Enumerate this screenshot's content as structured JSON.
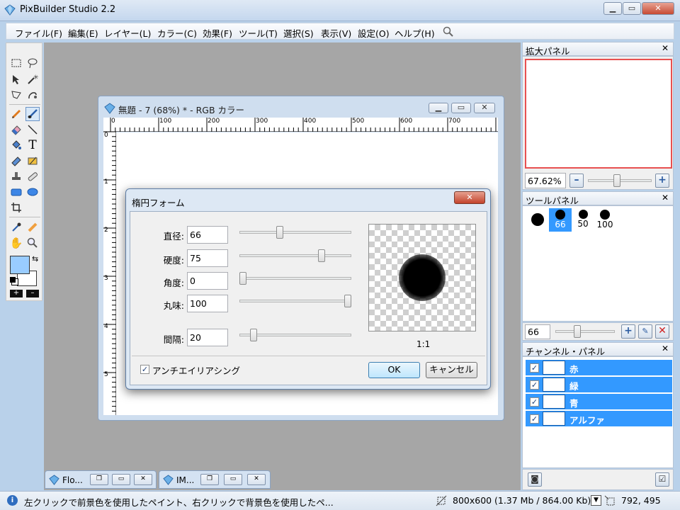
{
  "app": {
    "title": "PixBuilder Studio 2.2"
  },
  "menu": [
    "ファイル(F)",
    "編集(E)",
    "レイヤー(L)",
    "カラー(C)",
    "効果(F)",
    "ツール(T)",
    "選択(S)",
    "表示(V)",
    "設定(O)",
    "ヘルプ(H)"
  ],
  "document": {
    "title": "無題 - 7 (68%) * - RGB カラー",
    "ruler_h": [
      "0",
      "100",
      "200",
      "300",
      "400",
      "500",
      "600",
      "700"
    ],
    "ruler_v": [
      "0",
      "1",
      "2",
      "3",
      "4",
      "5"
    ]
  },
  "dialog": {
    "title": "楕円フォーム",
    "fields": [
      {
        "label": "直径:",
        "value": "66",
        "slider": 0.35
      },
      {
        "label": "硬度:",
        "value": "75",
        "slider": 0.75
      },
      {
        "label": "角度:",
        "value": "0",
        "slider": 0.0
      },
      {
        "label": "丸味:",
        "value": "100",
        "slider": 1.0
      },
      {
        "label": "間隔:",
        "value": "20",
        "slider": 0.1
      }
    ],
    "preview_label": "1:1",
    "antialias_label": "アンチエイリアシング",
    "antialias_checked": true,
    "ok_label": "OK",
    "cancel_label": "キャンセル"
  },
  "zoom_panel": {
    "title": "拡大パネル",
    "zoom_value": "67.62%",
    "minus": "–",
    "plus": "+"
  },
  "tool_panel": {
    "title": "ツールパネル",
    "brushes": [
      {
        "label": "",
        "selected": false
      },
      {
        "label": "66",
        "selected": true
      },
      {
        "label": "50",
        "selected": false
      },
      {
        "label": "100",
        "selected": false
      }
    ],
    "size_value": "66"
  },
  "channel_panel": {
    "title": "チャンネル・パネル",
    "channels": [
      "赤",
      "緑",
      "青",
      "アルファ"
    ]
  },
  "minimized": [
    {
      "label": "Flo..."
    },
    {
      "label": "IM..."
    }
  ],
  "status": {
    "hint": "左クリックで前景色を使用したペイント、右クリックで背景色を使用したペ...",
    "size": "800x600",
    "mem": "(1.37 Mb / 864.00 Kb)",
    "coords": "792, 495"
  },
  "colors": {
    "foreground": "#99ccff",
    "background": "#ffffff",
    "selection": "#3399ff"
  }
}
